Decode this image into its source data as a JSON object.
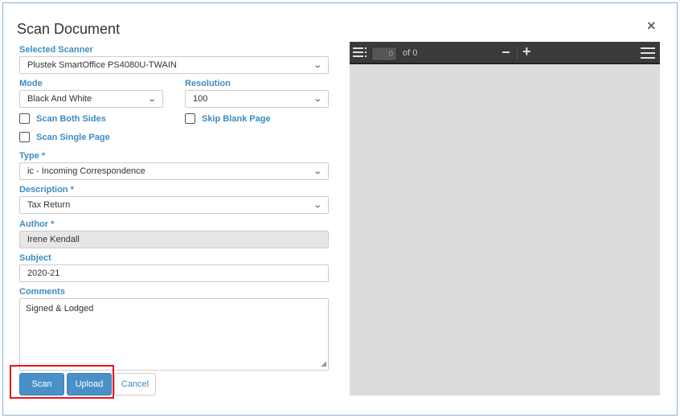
{
  "dialog": {
    "title": "Scan Document",
    "close_icon": "×"
  },
  "form": {
    "scanner_label": "Selected Scanner",
    "scanner_value": "Plustek SmartOffice PS4080U-TWAIN",
    "mode_label": "Mode",
    "mode_value": "Black And White",
    "resolution_label": "Resolution",
    "resolution_value": "100",
    "scan_both_sides": "Scan Both Sides",
    "skip_blank_page": "Skip Blank Page",
    "scan_single_page": "Scan Single Page",
    "type_label": "Type *",
    "type_value": "ic - Incoming Correspondence",
    "description_label": "Description *",
    "description_value": "Tax Return",
    "author_label": "Author *",
    "author_value": "Irene Kendall",
    "subject_label": "Subject",
    "subject_value": "2020-21",
    "comments_label": "Comments",
    "comments_value": "Signed & Lodged"
  },
  "buttons": {
    "scan": "Scan",
    "upload": "Upload",
    "cancel": "Cancel"
  },
  "viewer": {
    "page_value": "0",
    "page_of": "of 0",
    "zoom_out": "−",
    "zoom_in": "+"
  },
  "colors": {
    "accent": "#3b8cc4",
    "button": "#4a90c8",
    "highlight": "#e8151b"
  }
}
